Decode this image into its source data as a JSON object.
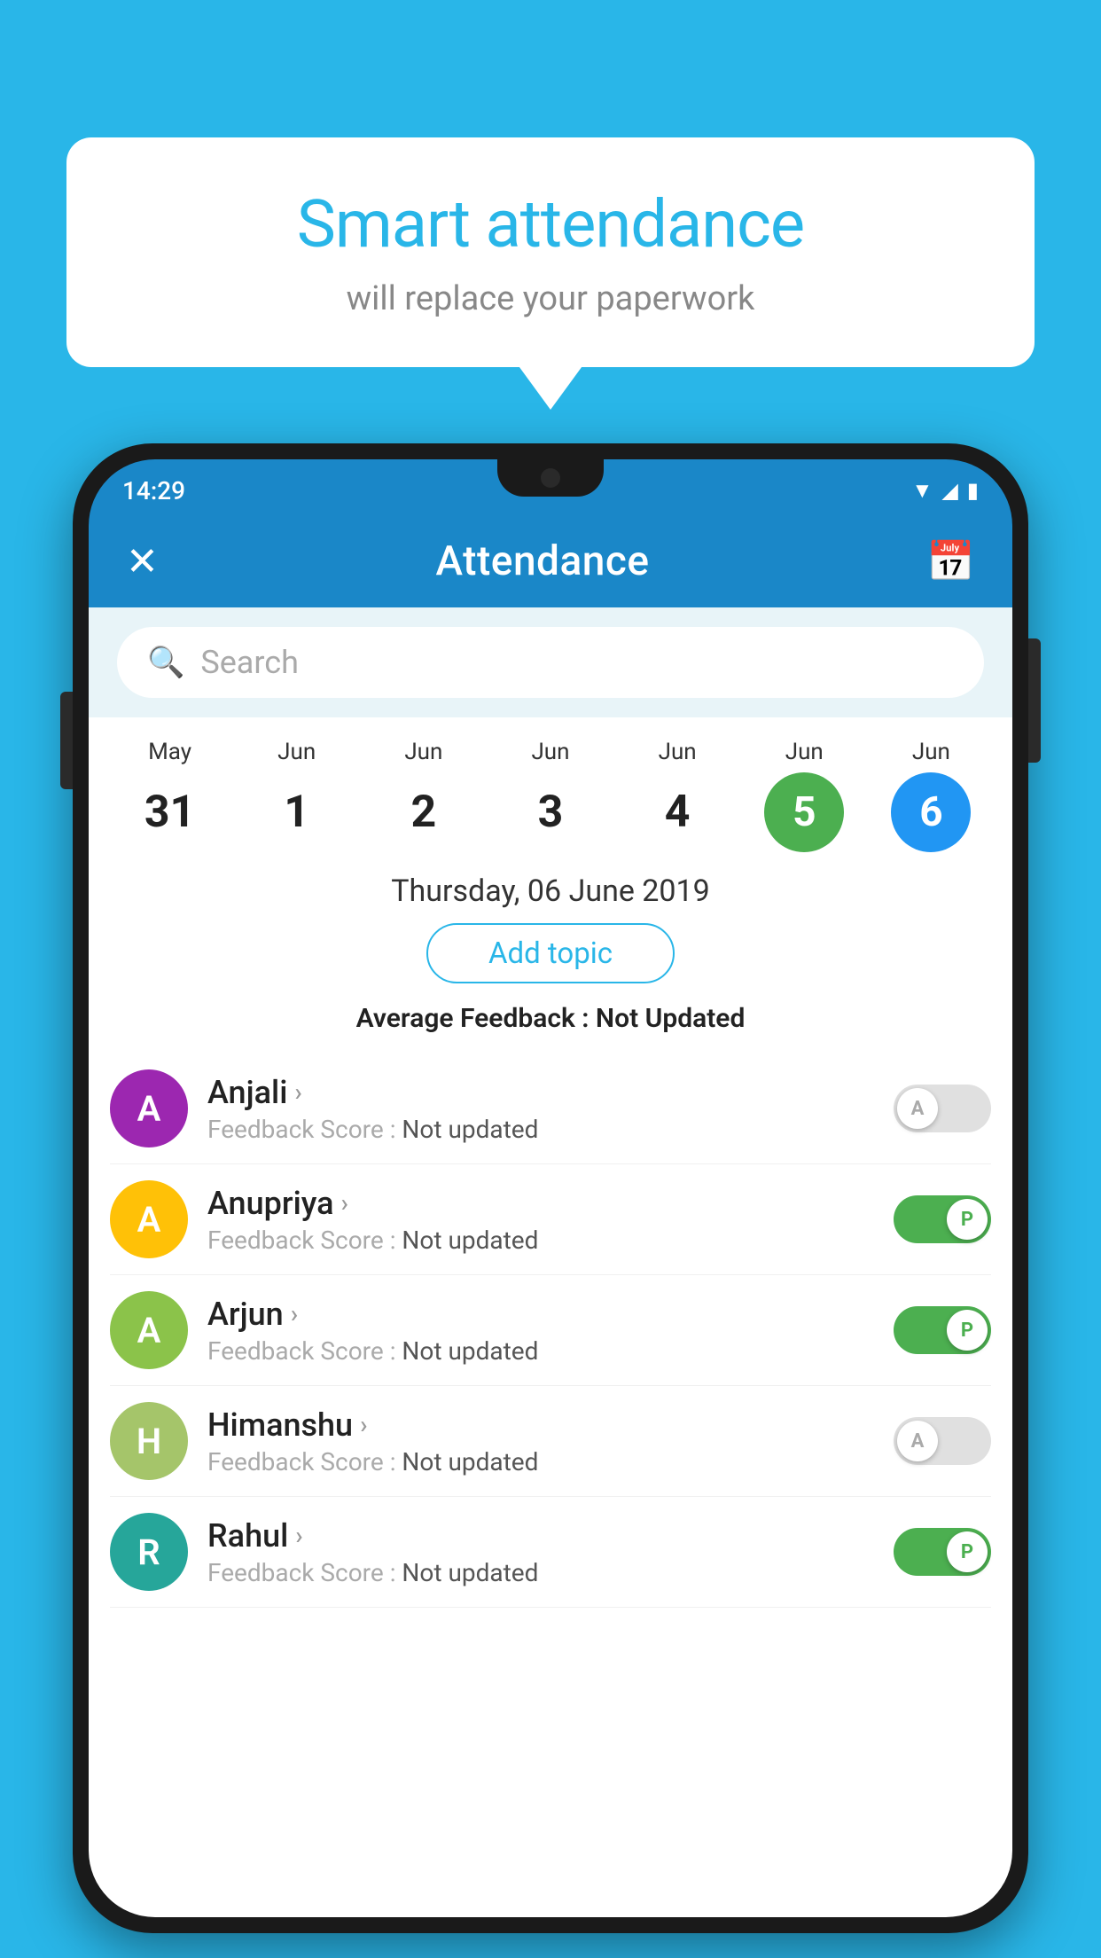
{
  "background_color": "#29b6e8",
  "speech_bubble": {
    "title": "Smart attendance",
    "subtitle": "will replace your paperwork"
  },
  "status_bar": {
    "time": "14:29",
    "wifi_icon": "▲",
    "signal_icon": "▲",
    "battery_icon": "▮"
  },
  "app_bar": {
    "title": "Attendance",
    "close_label": "✕",
    "calendar_icon": "📅"
  },
  "search": {
    "placeholder": "Search"
  },
  "calendar": {
    "dates": [
      {
        "month": "May",
        "day": "31",
        "style": "normal"
      },
      {
        "month": "Jun",
        "day": "1",
        "style": "normal"
      },
      {
        "month": "Jun",
        "day": "2",
        "style": "normal"
      },
      {
        "month": "Jun",
        "day": "3",
        "style": "normal"
      },
      {
        "month": "Jun",
        "day": "4",
        "style": "normal"
      },
      {
        "month": "Jun",
        "day": "5",
        "style": "today"
      },
      {
        "month": "Jun",
        "day": "6",
        "style": "selected"
      }
    ]
  },
  "selected_date_label": "Thursday, 06 June 2019",
  "add_topic_button": "Add topic",
  "average_feedback": {
    "label": "Average Feedback : ",
    "value": "Not Updated"
  },
  "students": [
    {
      "name": "Anjali",
      "avatar_letter": "A",
      "avatar_color": "purple",
      "feedback_label": "Feedback Score : ",
      "feedback_value": "Not updated",
      "toggle": "off",
      "toggle_letter": "A"
    },
    {
      "name": "Anupriya",
      "avatar_letter": "A",
      "avatar_color": "yellow",
      "feedback_label": "Feedback Score : ",
      "feedback_value": "Not updated",
      "toggle": "on",
      "toggle_letter": "P"
    },
    {
      "name": "Arjun",
      "avatar_letter": "A",
      "avatar_color": "green-light",
      "feedback_label": "Feedback Score : ",
      "feedback_value": "Not updated",
      "toggle": "on",
      "toggle_letter": "P"
    },
    {
      "name": "Himanshu",
      "avatar_letter": "H",
      "avatar_color": "olive",
      "feedback_label": "Feedback Score : ",
      "feedback_value": "Not updated",
      "toggle": "off",
      "toggle_letter": "A"
    },
    {
      "name": "Rahul",
      "avatar_letter": "R",
      "avatar_color": "teal",
      "feedback_label": "Feedback Score : ",
      "feedback_value": "Not updated",
      "toggle": "on",
      "toggle_letter": "P"
    }
  ]
}
